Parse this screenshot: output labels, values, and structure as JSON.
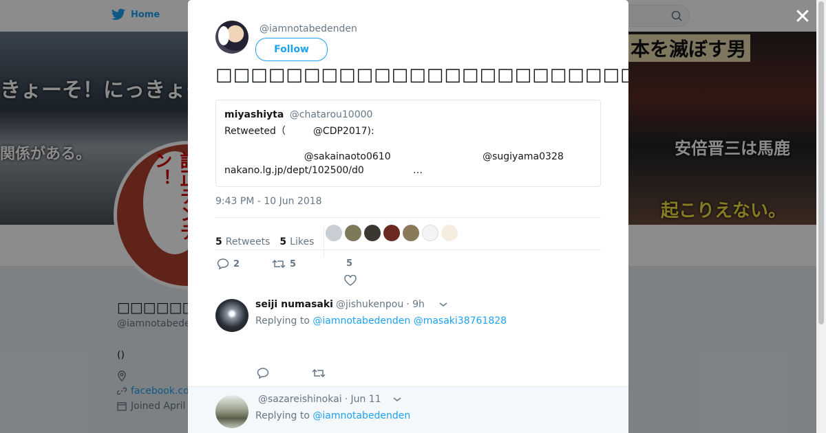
{
  "nav": {
    "home_label": "Home"
  },
  "banner": {
    "left_text": "きょーそ！にっきょーそ！",
    "left_text2": "関係がある。",
    "right_top_text": "本を滅ぼす男",
    "right_text": "安倍晋三は馬鹿",
    "right_bottom_text": "起こりえない。"
  },
  "profile": {
    "avatar_text": "訂正デンデン！",
    "name": "□□□□□□□□□□",
    "handle": "@iamnotabede",
    "bio": "()",
    "website": "facebook.co",
    "joined": "Joined April"
  },
  "modal": {
    "close_symbol": "✕",
    "author_handle": "@iamnotabedenden",
    "follow_label": "Follow",
    "tweet_text": "□□□□□□□□□□□□□□□□□□□□□□□□□□□□□□□□□□□□□□□□□□□□",
    "quote": {
      "name": "miyashiyta",
      "handle": "@chatarou10000",
      "line1": "Retweeted（         @CDP2017):",
      "line2": "                          @sakainaoto0610                              @sugiyama0328",
      "line3": "nakano.lg.jp/dept/102500/d0                …"
    },
    "timestamp": "9:43 PM - 10 Jun 2018",
    "stats": {
      "retweets_count": "5",
      "retweets_label": "Retweets",
      "likes_count": "5",
      "likes_label": "Likes"
    },
    "actions": {
      "reply_count": "2",
      "retweet_count": "5",
      "like_count": "5"
    },
    "replies": [
      {
        "name": "seiji numasaki",
        "handle": "@jishukenpou",
        "time": "· 9h",
        "replying_label": "Replying to",
        "replying_to": "@iamnotabedenden @masaki38761828"
      },
      {
        "name": "",
        "handle": "@sazareishinokai",
        "time": "· Jun 11",
        "replying_label": "Replying to",
        "replying_to": "@iamnotabedenden"
      }
    ]
  },
  "colors": {
    "accent": "#1da1f2",
    "text": "#14171a",
    "muted": "#657786"
  }
}
